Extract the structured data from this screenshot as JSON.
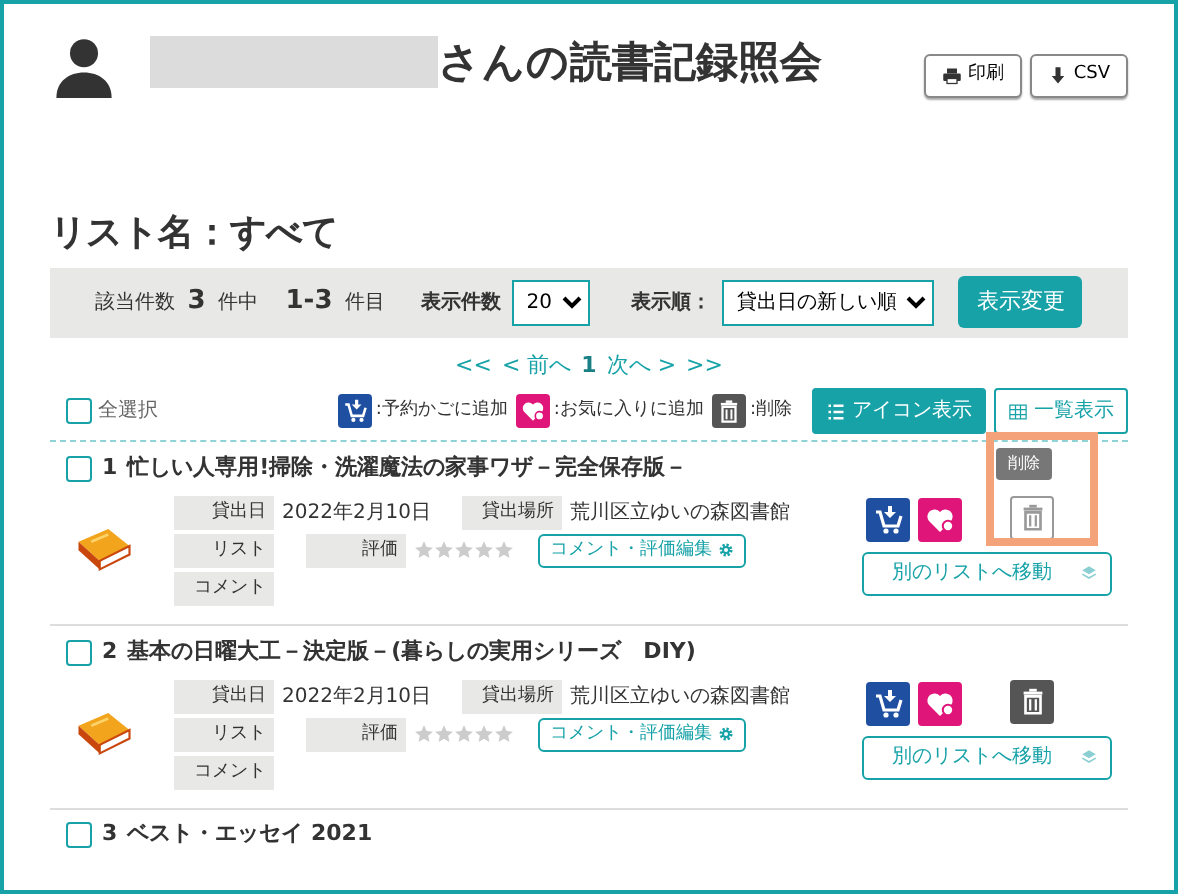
{
  "header": {
    "title": "さんの読書記録照会",
    "buttons": [
      {
        "label": "印刷",
        "kind": "print"
      },
      {
        "label": "CSV",
        "kind": "download"
      }
    ]
  },
  "list_name": "リスト名：すべて",
  "summary": {
    "total_label": "該当件数",
    "total": "3",
    "total_unit": "件中",
    "range": "1-3",
    "range_unit": "件目",
    "per_page_label": "表示件数",
    "per_page": "20",
    "sort_label": "表示順：",
    "sort": "貸出日の新しい順",
    "apply_button": "表示変更"
  },
  "pagination": [
    {
      "label": "<<",
      "selected": false
    },
    {
      "label": "< 前へ",
      "selected": false
    },
    {
      "label": "1",
      "selected": true
    },
    {
      "label": "次へ >",
      "selected": false
    },
    {
      "label": ">>",
      "selected": false
    }
  ],
  "select_all": {
    "label": "全選択",
    "checked": false
  },
  "legend": [
    {
      "kind": "cart",
      "label": ":予約かごに追加"
    },
    {
      "kind": "favorite",
      "label": ":お気に入りに追加"
    },
    {
      "kind": "delete",
      "label": ":削除"
    }
  ],
  "view_buttons": [
    {
      "label": "アイコン表示",
      "kind": "list",
      "selected": true
    },
    {
      "label": "一覧表示",
      "kind": "grid",
      "selected": false
    }
  ],
  "items": [
    {
      "number": "1",
      "title": "忙しい人専用!掃除・洗濯魔法の家事ワザ－完全保存版－",
      "checked": false,
      "loan_date_label": "貸出日",
      "loan_date": "2022年2月10日",
      "place_label": "貸出場所",
      "place": "荒川区立ゆいの森図書館",
      "list_label": "リスト",
      "rating_label": "評価",
      "stars": 0,
      "comment_label": "コメント",
      "comment_button": "コメント・評価編集",
      "move_button": "別のリストへ移動",
      "delete_highlighted": true,
      "delete_tooltip": "削除"
    },
    {
      "number": "2",
      "title": "基本の日曜大工－決定版－(暮らしの実用シリーズ　DIY)",
      "checked": false,
      "loan_date_label": "貸出日",
      "loan_date": "2022年2月10日",
      "place_label": "貸出場所",
      "place": "荒川区立ゆいの森図書館",
      "list_label": "リスト",
      "rating_label": "評価",
      "stars": 0,
      "comment_label": "コメント",
      "comment_button": "コメント・評価編集",
      "move_button": "別のリストへ移動",
      "delete_highlighted": false
    },
    {
      "number": "3",
      "title": "ベスト・エッセイ 2021",
      "checked": false
    }
  ]
}
